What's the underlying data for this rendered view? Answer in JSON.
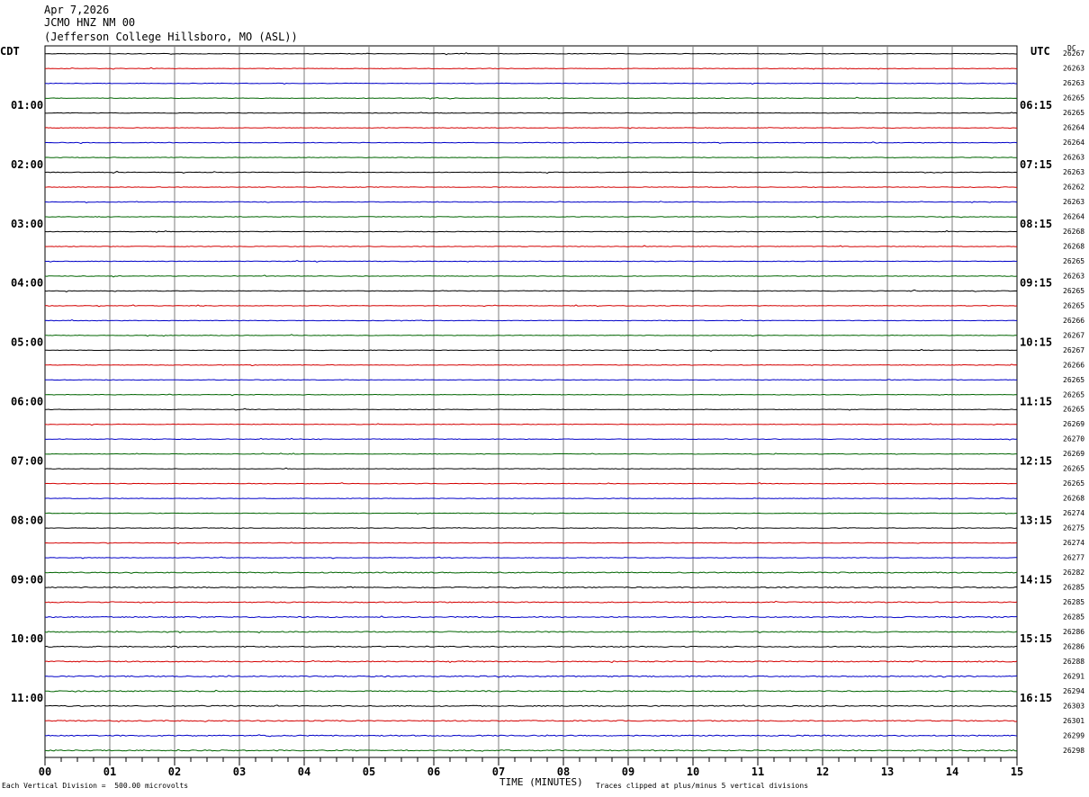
{
  "header": {
    "date": "Apr 7,2026",
    "station": "JCMO HNZ NM 00",
    "location": "(Jefferson College Hillsboro, MO (ASL))"
  },
  "axes": {
    "left_tz": "CDT",
    "right_tz": "UTC",
    "dc_label": "DC"
  },
  "footer": {
    "scale": "Each Vertical Division =  500.00 microvolts",
    "clip": "Traces clipped at plus/minus 5 vertical divisions",
    "xlabel": "TIME (MINUTES)"
  },
  "chart_data": {
    "type": "line",
    "xlabel": "TIME (MINUTES)",
    "xlim": [
      0,
      15
    ],
    "x_ticks": [
      "00",
      "01",
      "02",
      "03",
      "04",
      "05",
      "06",
      "07",
      "08",
      "09",
      "10",
      "11",
      "12",
      "13",
      "14",
      "15"
    ],
    "trace_colors": [
      "#000000",
      "#d40000",
      "#0000c8",
      "#006400"
    ],
    "left_time_labels": [
      "01:00",
      "02:00",
      "03:00",
      "04:00",
      "05:00",
      "06:00",
      "07:00",
      "08:00",
      "09:00",
      "10:00",
      "11:00"
    ],
    "right_time_labels": [
      "06:15",
      "07:15",
      "08:15",
      "09:15",
      "10:15",
      "11:15",
      "12:15",
      "13:15",
      "14:15",
      "15:15",
      "16:15"
    ],
    "dc_values": [
      26267,
      26263,
      26263,
      26265,
      26265,
      26264,
      26264,
      26263,
      26263,
      26262,
      26263,
      26264,
      26268,
      26268,
      26265,
      26263,
      26265,
      26265,
      26266,
      26267,
      26267,
      26266,
      26265,
      26265,
      26265,
      26269,
      26270,
      26269,
      26265,
      26265,
      26268,
      26274,
      26275,
      26274,
      26277,
      26282,
      26285,
      26285,
      26285,
      26286,
      26286,
      26288,
      26291,
      26294,
      26303,
      26301,
      26299,
      26298
    ]
  }
}
